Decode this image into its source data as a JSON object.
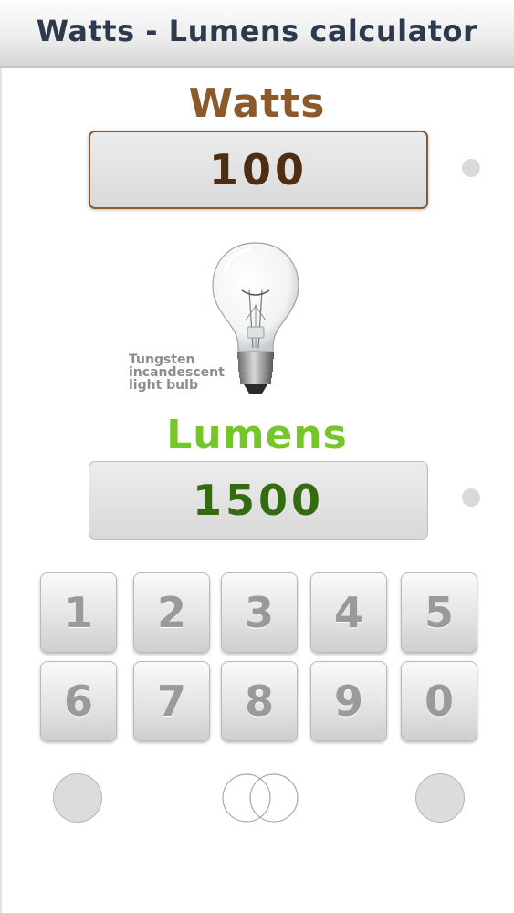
{
  "header": {
    "title": "Watts - Lumens calculator"
  },
  "watts": {
    "label": "Watts",
    "value": "100"
  },
  "bulb": {
    "caption": [
      "Tungsten",
      "incandescent",
      "light bulb"
    ]
  },
  "lumens": {
    "label": "Lumens",
    "value": "1500"
  },
  "keypad": {
    "keys": [
      "1",
      "2",
      "3",
      "4",
      "5",
      "6",
      "7",
      "8",
      "9",
      "0"
    ]
  },
  "colors": {
    "watts_accent": "#8a5a2c",
    "watts_value": "#4d2e14",
    "lumens_accent": "#76c52a",
    "lumens_value": "#356b10",
    "title": "#2d3a4e"
  },
  "icons": {
    "bulb": "light-bulb-icon",
    "overlap": "overlapping-circles-icon"
  }
}
